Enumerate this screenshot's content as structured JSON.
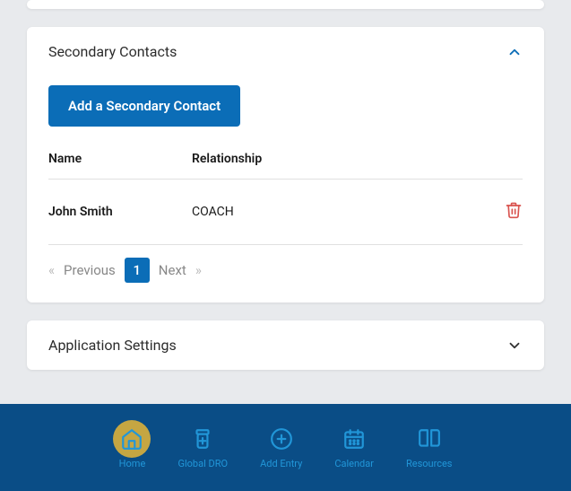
{
  "sections": {
    "secondary": {
      "title": "Secondary Contacts",
      "expanded": true
    },
    "appsettings": {
      "title": "Application Settings",
      "expanded": false
    }
  },
  "add_button": "Add a Secondary Contact",
  "columns": {
    "name": "Name",
    "relationship": "Relationship"
  },
  "contacts": [
    {
      "name": "John Smith",
      "relationship": "COACH"
    }
  ],
  "pager": {
    "prev": "Previous",
    "next": "Next",
    "current": "1"
  },
  "nav": {
    "home": "Home",
    "globaldro": "Global DRO",
    "addentry": "Add Entry",
    "calendar": "Calendar",
    "resources": "Resources"
  }
}
